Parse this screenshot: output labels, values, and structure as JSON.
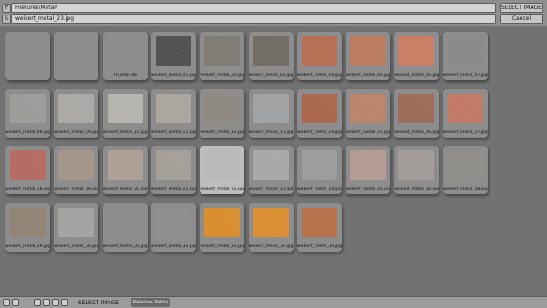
{
  "header": {
    "dir_toggle": "P",
    "file_toggle": "S",
    "directory": "Filetures\\Metal\\",
    "filename": "weikert_metal_23.jpg",
    "select_label": "SELECT IMAGE",
    "cancel_label": "Cancel"
  },
  "footer": {
    "select_label": "SELECT IMAGE",
    "relative_label": "Relative Paths"
  },
  "tiles": [
    {
      "label": "",
      "kind": "folder",
      "color": ""
    },
    {
      "label": "",
      "kind": "folder",
      "color": ""
    },
    {
      "label": "Thumbs.db",
      "kind": "folder",
      "color": ""
    },
    {
      "label": "weikert_metal_01.jpg",
      "kind": "image",
      "color": "#4e5050"
    },
    {
      "label": "weikert_metal_02.jpg",
      "kind": "image",
      "color": "#7d7a72"
    },
    {
      "label": "weikert_metal_03.jpg",
      "kind": "image",
      "color": "#6f6a63"
    },
    {
      "label": "weikert_metal_04.jpg",
      "kind": "image",
      "color": "#b56c52"
    },
    {
      "label": "weikert_metal_05.jpg",
      "kind": "image",
      "color": "#b97a5e"
    },
    {
      "label": "weikert_metal_06.jpg",
      "kind": "image",
      "color": "#c97c62"
    },
    {
      "label": "weikert_metal_07.jpg",
      "kind": "image",
      "color": "#8a8886"
    },
    {
      "label": "weikert_metal_08.jpg",
      "kind": "image",
      "color": "#9a9a98"
    },
    {
      "label": "weikert_metal_09.jpg",
      "kind": "image",
      "color": "#a9a8a4"
    },
    {
      "label": "weikert_metal_10.jpg",
      "kind": "image",
      "color": "#b4b3ae"
    },
    {
      "label": "weikert_metal_11.jpg",
      "kind": "image",
      "color": "#a9a49c"
    },
    {
      "label": "weikert_metal_12.jpg",
      "kind": "image",
      "color": "#8c8780"
    },
    {
      "label": "weikert_metal_13.jpg",
      "kind": "image",
      "color": "#9fa0a1"
    },
    {
      "label": "weikert_metal_14.jpg",
      "kind": "image",
      "color": "#a8654c"
    },
    {
      "label": "weikert_metal_15.jpg",
      "kind": "image",
      "color": "#b88368"
    },
    {
      "label": "weikert_metal_16.jpg",
      "kind": "image",
      "color": "#9a6a56"
    },
    {
      "label": "weikert_metal_17.jpg",
      "kind": "image",
      "color": "#c07763"
    },
    {
      "label": "weikert_metal_18.jpg",
      "kind": "image",
      "color": "#b26a60"
    },
    {
      "label": "weikert_metal_19.jpg",
      "kind": "image",
      "color": "#a3948a"
    },
    {
      "label": "weikert_metal_20.jpg",
      "kind": "image",
      "color": "#ab9f95"
    },
    {
      "label": "weikert_metal_21.jpg",
      "kind": "image",
      "color": "#a49e98"
    },
    {
      "label": "weikert_metal_22.jpg",
      "kind": "image",
      "color": "#b8b8b8"
    },
    {
      "label": "weikert_metal_23.jpg",
      "kind": "image",
      "color": "#a7a7a7"
    },
    {
      "label": "weikert_metal_24.jpg",
      "kind": "image",
      "color": "#9b9b9c"
    },
    {
      "label": "weikert_metal_25.jpg",
      "kind": "image",
      "color": "#b29a92"
    },
    {
      "label": "weikert_metal_26.jpg",
      "kind": "image",
      "color": "#a19b98"
    },
    {
      "label": "weikert_metal_28.jpg",
      "kind": "image",
      "color": "#8e8c88"
    },
    {
      "label": "weikert_metal_29.jpg",
      "kind": "image",
      "color": "#8f8273"
    },
    {
      "label": "weikert_metal_30.jpg",
      "kind": "image",
      "color": "#a2a2a0"
    },
    {
      "label": "weikert_metal_31.jpg",
      "kind": "image",
      "color": "#8a8a8a"
    },
    {
      "label": "weikert_metal_32.jpg",
      "kind": "image",
      "color": "#8d8d8e"
    },
    {
      "label": "weikert_metal_33.jpg",
      "kind": "image",
      "color": "#d88c2c"
    },
    {
      "label": "weikert_metal_34.jpg",
      "kind": "image",
      "color": "#d98d30"
    },
    {
      "label": "weikert_metal_35.jpg",
      "kind": "image",
      "color": "#b56f47"
    }
  ],
  "selected_tile": "weikert_metal_22.jpg"
}
